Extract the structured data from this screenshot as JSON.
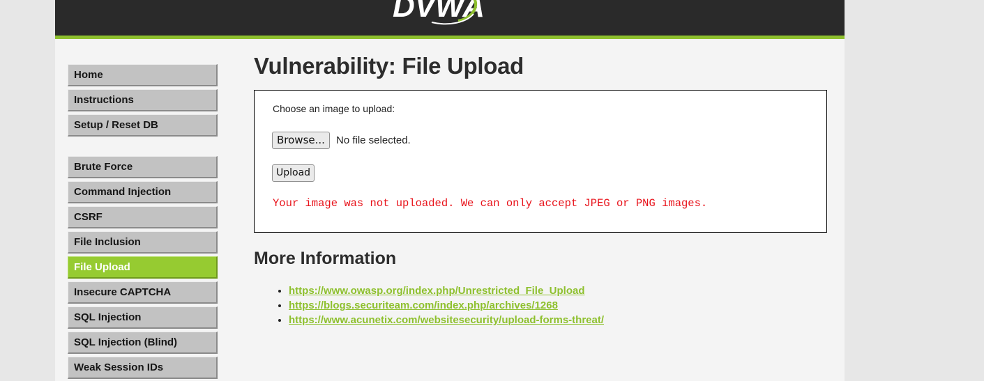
{
  "header": {
    "logo_text": "DVWA",
    "accent_color": "#8ec02e"
  },
  "menu": {
    "items_top": [
      {
        "label": "Home"
      },
      {
        "label": "Instructions"
      },
      {
        "label": "Setup / Reset DB"
      }
    ],
    "items_vuln": [
      {
        "label": "Brute Force"
      },
      {
        "label": "Command Injection"
      },
      {
        "label": "CSRF"
      },
      {
        "label": "File Inclusion"
      },
      {
        "label": "File Upload",
        "selected": true
      },
      {
        "label": "Insecure CAPTCHA"
      },
      {
        "label": "SQL Injection"
      },
      {
        "label": "SQL Injection (Blind)"
      },
      {
        "label": "Weak Session IDs"
      }
    ]
  },
  "main": {
    "title": "Vulnerability: File Upload",
    "form": {
      "label": "Choose an image to upload:",
      "browse_label": "Browse...",
      "file_status": "No file selected.",
      "upload_label": "Upload",
      "error": "Your image was not uploaded. We can only accept JPEG or PNG images."
    },
    "more_info_title": "More Information",
    "links": [
      "https://www.owasp.org/index.php/Unrestricted_File_Upload",
      "https://blogs.securiteam.com/index.php/archives/1268",
      "https://www.acunetix.com/websitesecurity/upload-forms-threat/"
    ]
  }
}
